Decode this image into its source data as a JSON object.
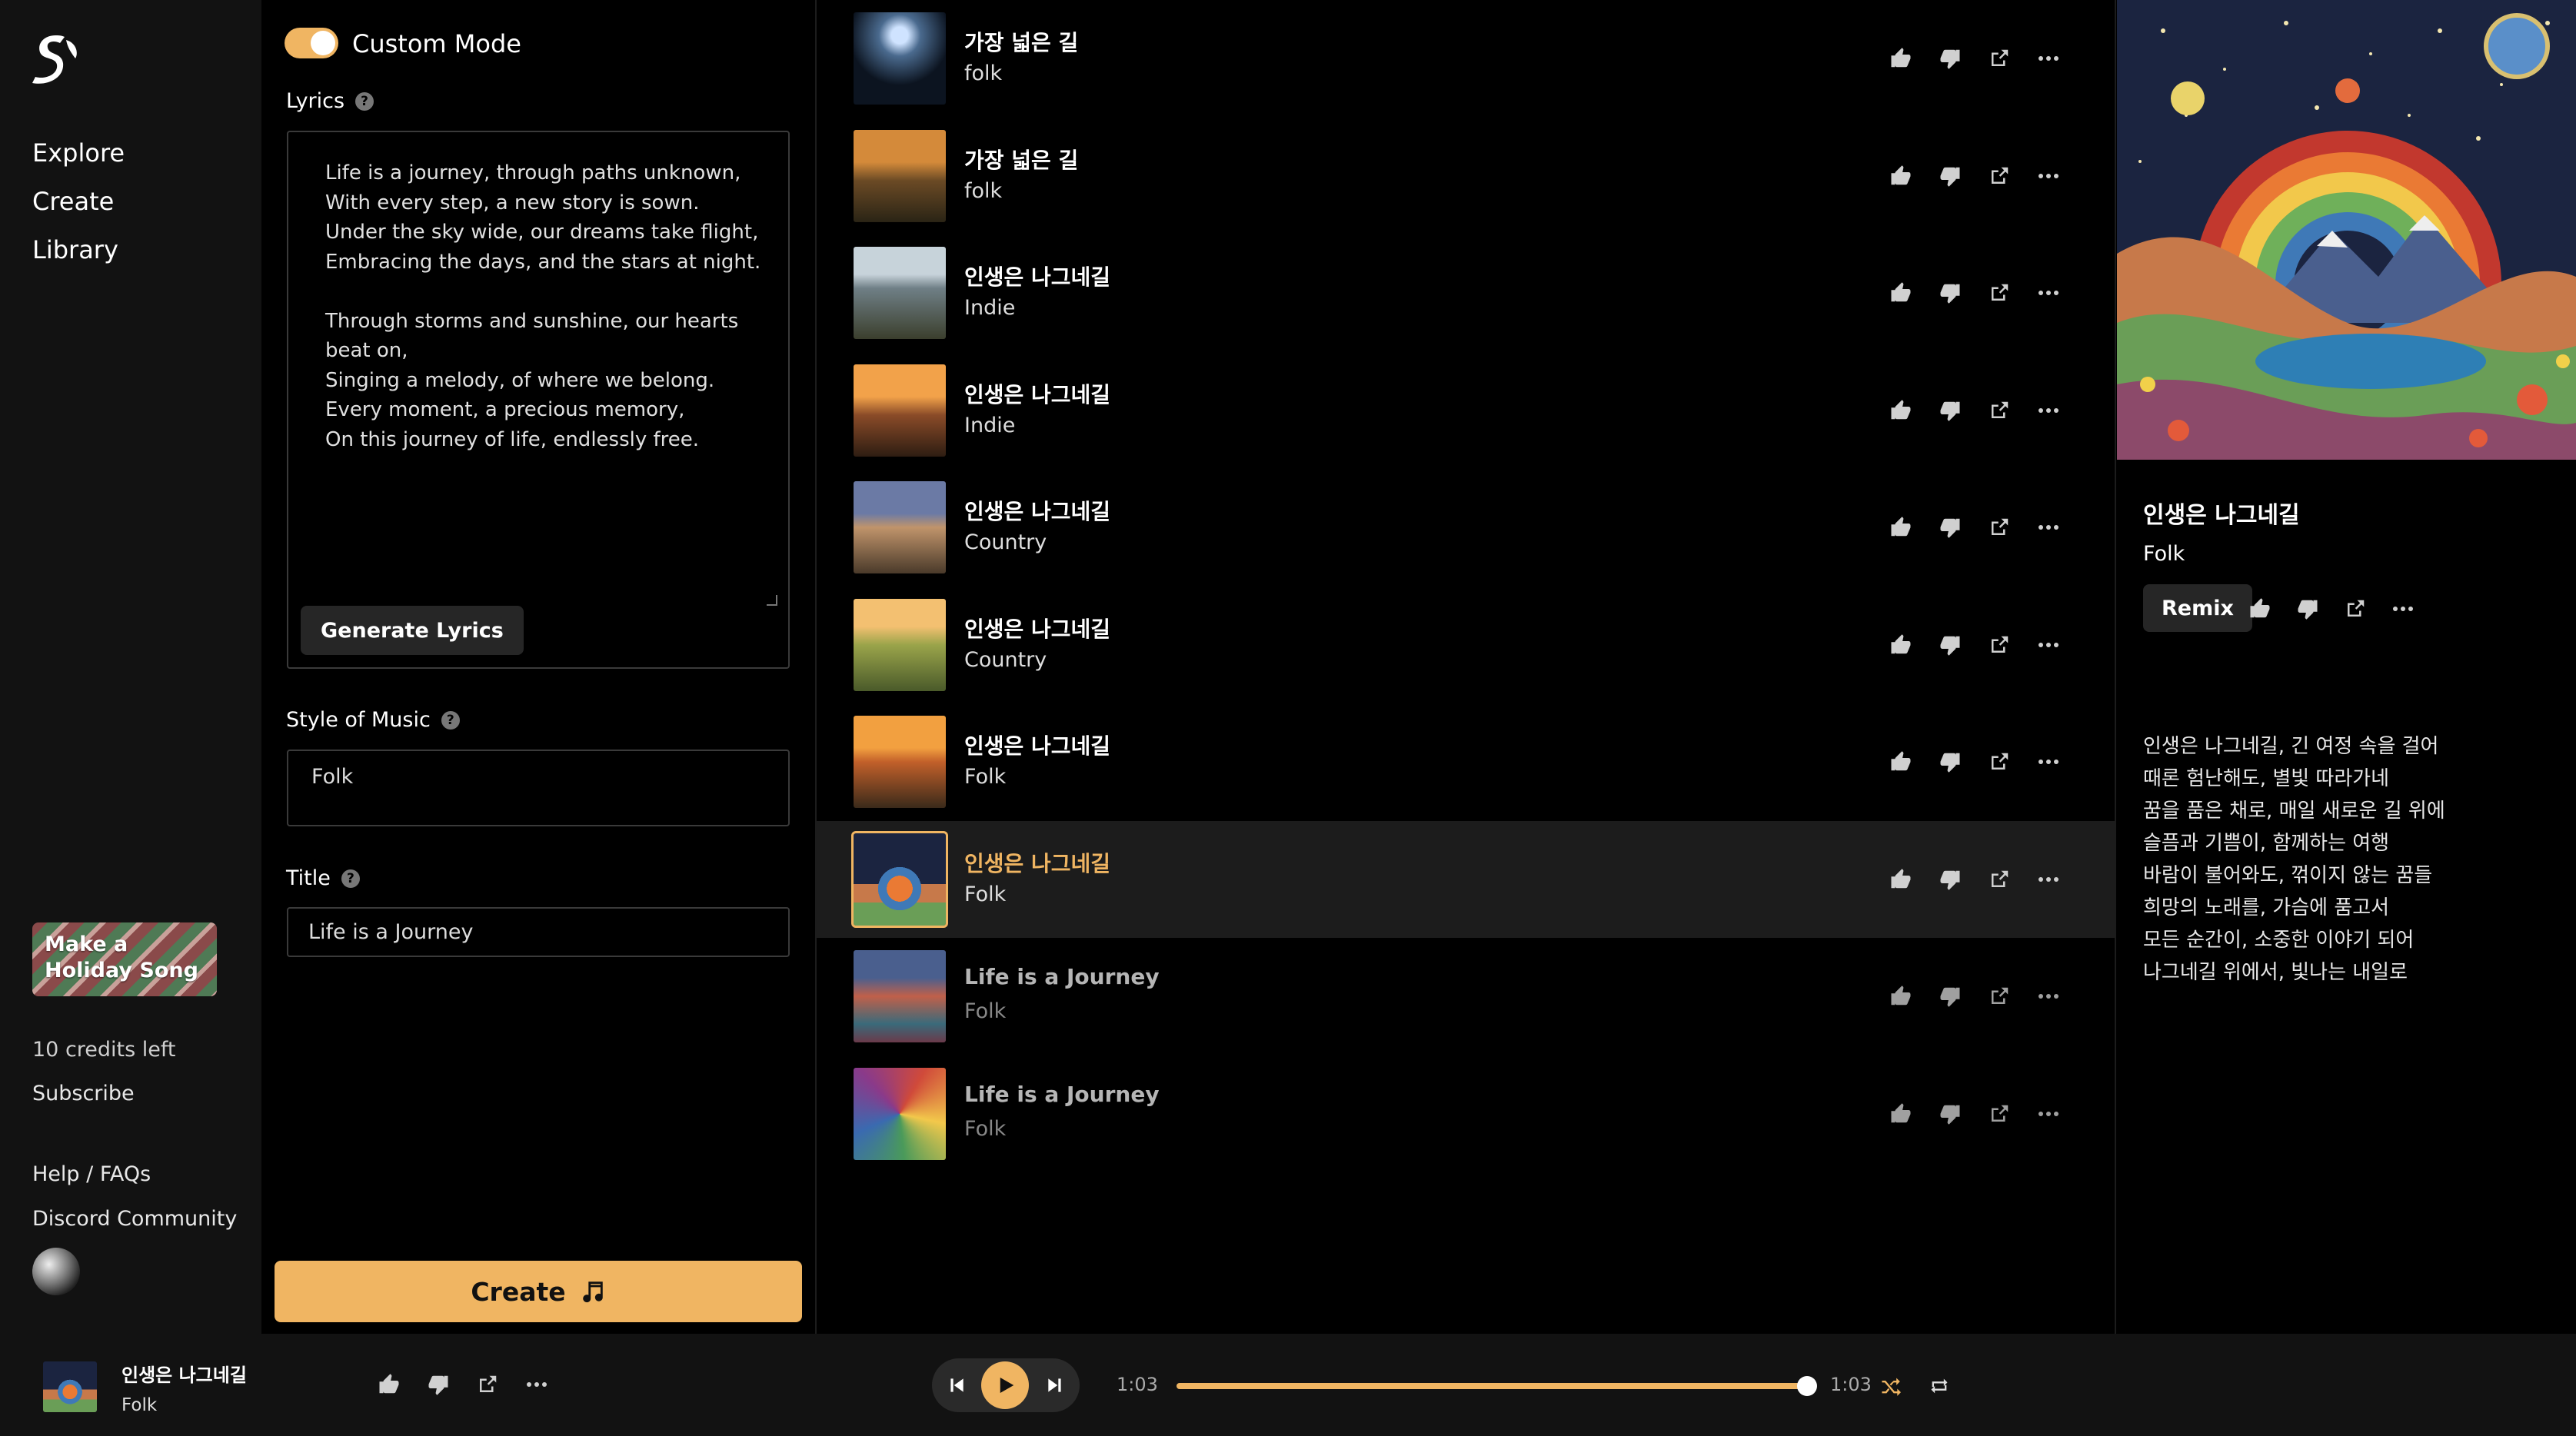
{
  "nav": {
    "links": [
      "Explore",
      "Create",
      "Library"
    ],
    "promo": "Make a Holiday Song",
    "credits": "10 credits left",
    "subscribe": "Subscribe",
    "help": "Help / FAQs",
    "discord": "Discord Community"
  },
  "create": {
    "custom_mode": "Custom Mode",
    "custom_mode_on": true,
    "lyrics_label": "Lyrics",
    "lyrics": "Life is a journey, through paths unknown,\nWith every step, a new story is sown.\nUnder the sky wide, our dreams take flight,\nEmbracing the days, and the stars at night.\n\nThrough storms and sunshine, our hearts\nbeat on,\nSinging a melody, of where we belong.\nEvery moment, a precious memory,\nOn this journey of life, endlessly free.",
    "generate_lyrics": "Generate Lyrics",
    "style_label": "Style of Music",
    "style_value": "Folk",
    "title_label": "Title",
    "title_value": "Life is a Journey",
    "create_button": "Create"
  },
  "songs": [
    {
      "title": "가장 넓은 길",
      "genre": "folk"
    },
    {
      "title": "가장 넓은 길",
      "genre": "folk"
    },
    {
      "title": "인생은 나그네길",
      "genre": "Indie"
    },
    {
      "title": "인생은 나그네길",
      "genre": "Indie"
    },
    {
      "title": "인생은 나그네길",
      "genre": "Country"
    },
    {
      "title": "인생은 나그네길",
      "genre": "Country"
    },
    {
      "title": "인생은 나그네길",
      "genre": "Folk"
    },
    {
      "title": "인생은 나그네길",
      "genre": "Folk"
    },
    {
      "title": "Life is a Journey",
      "genre": "Folk"
    },
    {
      "title": "Life is a Journey",
      "genre": "Folk"
    }
  ],
  "detail": {
    "title": "인생은 나그네길",
    "genre": "Folk",
    "remix": "Remix",
    "lyrics": [
      "인생은 나그네길, 긴 여정 속을 걸어",
      "때론 험난해도, 별빛 따라가네",
      "꿈을 품은 채로, 매일 새로운 길 위에",
      "슬픔과 기쁨이, 함께하는 여행",
      "바람이 불어와도, 꺾이지 않는 꿈들",
      "희망의 노래를, 가슴에 품고서",
      "모든 순간이, 소중한 이야기 되어",
      "나그네길 위에서, 빛나는 내일로"
    ]
  },
  "player": {
    "title": "인생은 나그네길",
    "genre": "Folk",
    "elapsed": "1:03",
    "duration": "1:03",
    "progress": 1.0
  },
  "colors": {
    "accent": "#f0b562",
    "sidebar": "#121212",
    "active_row": "#1c1c1c"
  }
}
